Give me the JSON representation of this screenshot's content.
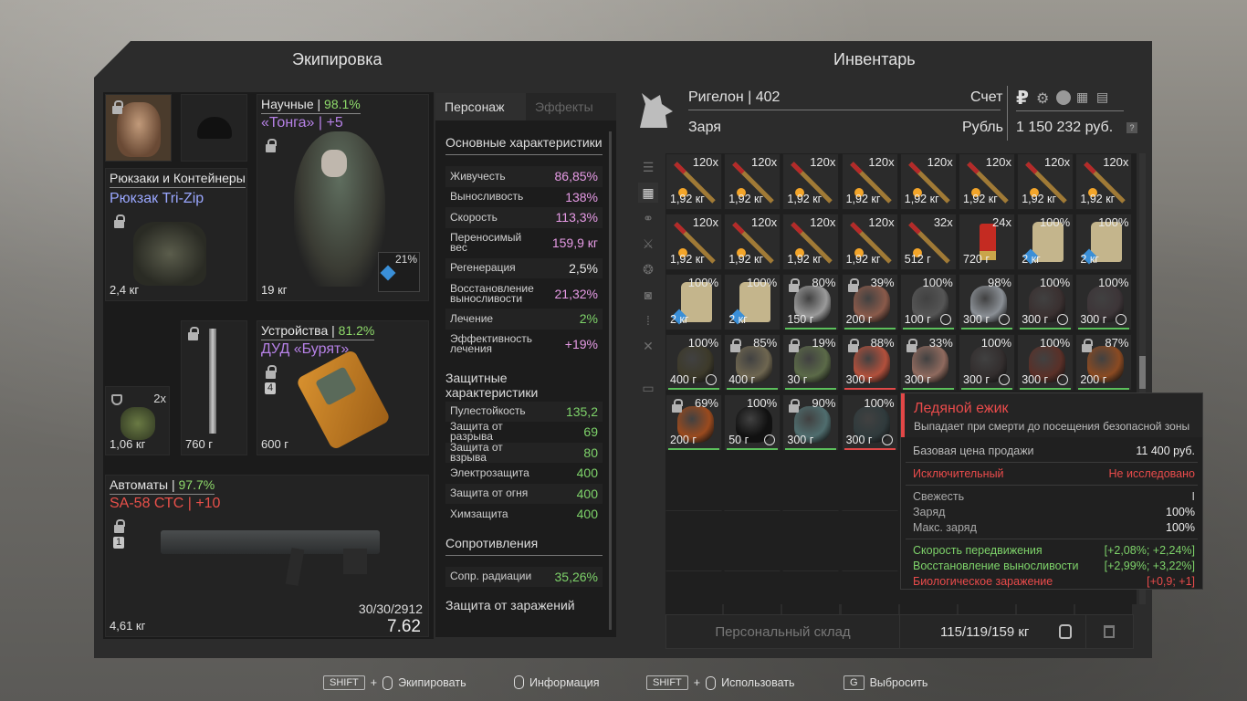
{
  "equipment": {
    "title": "Экипировка",
    "backpack": {
      "header": "Рюкзаки и Контейнеры",
      "name": "Рюкзак Tri-Zip",
      "weight": "2,4 кг"
    },
    "armor": {
      "header_label": "Научные",
      "header_sep": " | ",
      "header_pct": "98.1%",
      "name": "«Тонга» | +5",
      "weight": "19 кг",
      "slot_pct": "21%"
    },
    "grenade": {
      "count": "2x",
      "weight": "1,06 кг"
    },
    "melee": {
      "weight": "760 г"
    },
    "device": {
      "header_label": "Устройства",
      "header_sep": " | ",
      "header_pct": "81.2%",
      "name": "ДУД «Бурят»",
      "weight": "600 г",
      "num": "4"
    },
    "weapon": {
      "header_label": "Автоматы",
      "header_sep": " | ",
      "header_pct": "97.7%",
      "name": "SA-58 СТС | +10",
      "weight": "4,61 кг",
      "ammo": "30/30/2912",
      "caliber": "7.62",
      "num": "1"
    }
  },
  "stats": {
    "tabs": [
      "Персонаж",
      "Эффекты"
    ],
    "sections": {
      "main": "Основные характеристики",
      "protect": "Защитные характеристики",
      "resist": "Сопротивления",
      "contam": "Защита от заражений"
    },
    "main_rows": [
      {
        "label": "Живучесть",
        "value": "86,85%"
      },
      {
        "label": "Выносливость",
        "value": "138%"
      },
      {
        "label": "Скорость",
        "value": "113,3%"
      },
      {
        "label": "Переносимый вес",
        "value": "159,9 кг"
      },
      {
        "label": "Регенерация",
        "value": "2,5%"
      },
      {
        "label": "Восстановление выносливости",
        "value": "21,32%"
      },
      {
        "label": "Лечение",
        "value": "2%"
      },
      {
        "label": "Эффективность лечения",
        "value": "+19%"
      }
    ],
    "protect_rows": [
      {
        "label": "Пулестойкость",
        "value": "135,2"
      },
      {
        "label": "Защита от разрыва",
        "value": "69"
      },
      {
        "label": "Защита от взрыва",
        "value": "80"
      },
      {
        "label": "Электрозащита",
        "value": "400"
      },
      {
        "label": "Защита от огня",
        "value": "400"
      },
      {
        "label": "Химзащита",
        "value": "400"
      }
    ],
    "resist_rows": [
      {
        "label": "Сопр. радиации",
        "value": "35,26%"
      }
    ]
  },
  "inventory": {
    "title": "Инвентарь",
    "player": "Ригелон | 402",
    "faction": "Заря",
    "account_label": "Счет",
    "currency_label": "Рубль",
    "money": "1 150 232 руб.",
    "help": "?",
    "storage_label": "Персональный склад",
    "weight_summary": "115/119/159 кг",
    "items": [
      {
        "c": "120x",
        "w": "1,92 кг",
        "t": "ammo"
      },
      {
        "c": "120x",
        "w": "1,92 кг",
        "t": "ammo"
      },
      {
        "c": "120x",
        "w": "1,92 кг",
        "t": "ammo"
      },
      {
        "c": "120x",
        "w": "1,92 кг",
        "t": "ammo"
      },
      {
        "c": "120x",
        "w": "1,92 кг",
        "t": "ammo"
      },
      {
        "c": "120x",
        "w": "1,92 кг",
        "t": "ammo"
      },
      {
        "c": "120x",
        "w": "1,92 кг",
        "t": "ammo"
      },
      {
        "c": "120x",
        "w": "1,92 кг",
        "t": "ammo"
      },
      {
        "c": "120x",
        "w": "1,92 кг",
        "t": "ammo"
      },
      {
        "c": "120x",
        "w": "1,92 кг",
        "t": "ammo"
      },
      {
        "c": "120x",
        "w": "1,92 кг",
        "t": "ammo"
      },
      {
        "c": "120x",
        "w": "1,92 кг",
        "t": "ammo"
      },
      {
        "c": "32x",
        "w": "512 г",
        "t": "ammo"
      },
      {
        "c": "24x",
        "w": "720 г",
        "t": "shell"
      },
      {
        "c": "100%",
        "w": "2 кг",
        "t": "plate"
      },
      {
        "c": "100%",
        "w": "2 кг",
        "t": "plate"
      },
      {
        "c": "100%",
        "w": "2 кг",
        "t": "plate"
      },
      {
        "c": "100%",
        "w": "2 кг",
        "t": "plate"
      },
      {
        "c": "80%",
        "w": "150 г",
        "t": "art",
        "col": "#9a9a9a",
        "lock": true
      },
      {
        "c": "39%",
        "w": "200 г",
        "t": "art",
        "col": "#8a5a4a",
        "lock": true
      },
      {
        "c": "100%",
        "w": "100 г",
        "t": "art",
        "col": "#555",
        "clock": true
      },
      {
        "c": "98%",
        "w": "300 г",
        "t": "art",
        "col": "#8a8f95",
        "clock": true
      },
      {
        "c": "100%",
        "w": "300 г",
        "t": "art",
        "col": "#3a3030",
        "clock": true
      },
      {
        "c": "100%",
        "w": "300 г",
        "t": "art",
        "col": "#3d3538",
        "clock": true
      },
      {
        "c": "100%",
        "w": "400 г",
        "t": "art",
        "col": "#3d3a2a",
        "clock": true
      },
      {
        "c": "85%",
        "w": "400 г",
        "t": "art",
        "col": "#6e6650",
        "lock": true
      },
      {
        "c": "19%",
        "w": "30 г",
        "t": "art",
        "col": "#5b6a48",
        "lock": true
      },
      {
        "c": "88%",
        "w": "300 г",
        "t": "art",
        "col": "#b2503c",
        "lock": true,
        "red": true
      },
      {
        "c": "33%",
        "w": "300 г",
        "t": "art",
        "col": "#8f6a5e",
        "lock": true
      },
      {
        "c": "100%",
        "w": "300 г",
        "t": "art",
        "col": "#332e2e",
        "clock": true
      },
      {
        "c": "100%",
        "w": "300 г",
        "t": "art",
        "col": "#5a3028",
        "clock": true
      },
      {
        "c": "87%",
        "w": "200 г",
        "t": "art",
        "col": "#8a4a22",
        "lock": true
      },
      {
        "c": "69%",
        "w": "200 г",
        "t": "art",
        "col": "#9a4a1e",
        "lock": true
      },
      {
        "c": "100%",
        "w": "50 г",
        "t": "art",
        "col": "#111",
        "clock": true
      },
      {
        "c": "90%",
        "w": "300 г",
        "t": "art",
        "col": "#4f6d6e",
        "lock": true
      },
      {
        "c": "100%",
        "w": "300 г",
        "t": "art",
        "col": "#2f3a3c",
        "clock": true,
        "red": true
      }
    ]
  },
  "tooltip": {
    "title": "Ледяной ежик",
    "desc": "Выпадает при смерти до посещения безопасной зоны",
    "price_label": "Базовая цена продажи",
    "price": "11 400 руб.",
    "rarity": "Исключительный",
    "research": "Не исследовано",
    "fresh_label": "Свежесть",
    "fresh": "I",
    "charge_label": "Заряд",
    "charge": "100%",
    "maxcharge_label": "Макс. заряд",
    "maxcharge": "100%",
    "effects": [
      {
        "label": "Скорость передвижения",
        "value": "[+2,08%; +2,24%]",
        "good": true
      },
      {
        "label": "Восстановление выносливости",
        "value": "[+2,99%; +3,22%]",
        "good": true
      },
      {
        "label": "Биологическое заражение",
        "value": "[+0,9; +1]",
        "good": false
      }
    ]
  },
  "hints": [
    {
      "key": "SHIFT",
      "plus": "+",
      "label": "Экипировать"
    },
    {
      "label": "Информация"
    },
    {
      "key": "SHIFT",
      "plus": "+",
      "label": "Использовать"
    },
    {
      "key": "G",
      "label": "Выбросить"
    }
  ],
  "colors": {
    "accent_red": "#e24747",
    "green": "#7ed36a",
    "pink": "#e79be6",
    "purple": "#b681e6"
  }
}
